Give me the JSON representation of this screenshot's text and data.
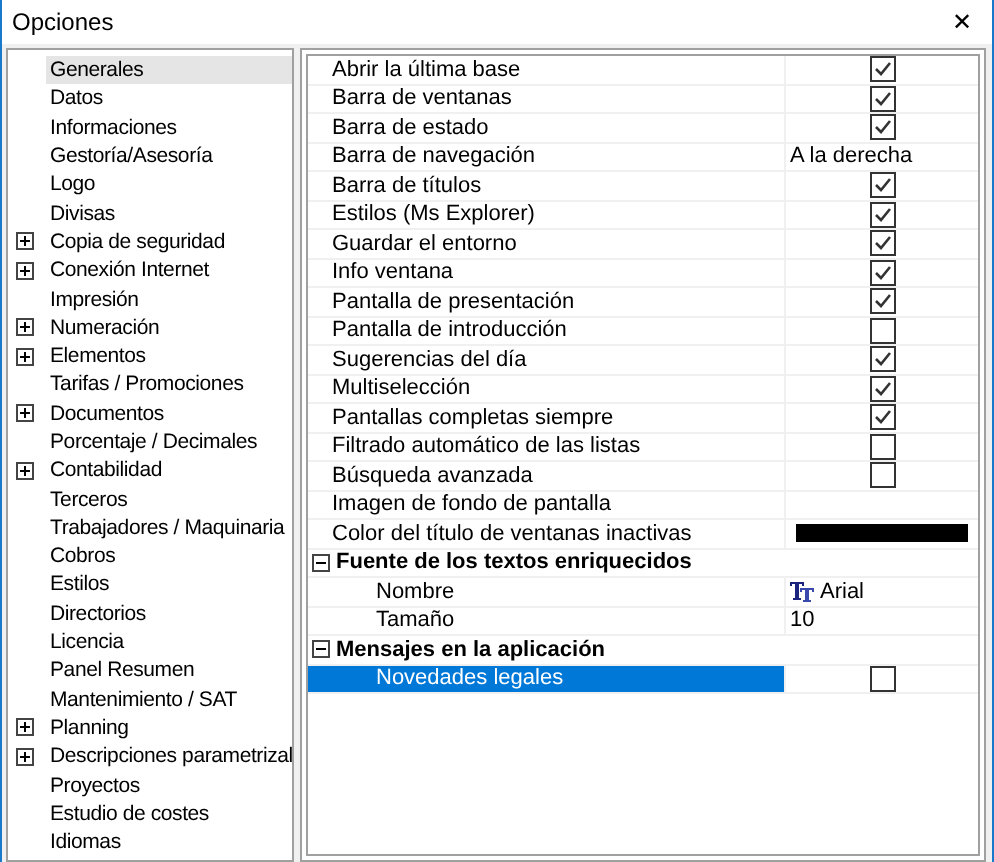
{
  "window": {
    "title": "Opciones",
    "close": "✕"
  },
  "tree": {
    "items": [
      {
        "label": "Generales",
        "expandable": false,
        "selected": true
      },
      {
        "label": "Datos",
        "expandable": false,
        "selected": false
      },
      {
        "label": "Informaciones",
        "expandable": false,
        "selected": false
      },
      {
        "label": "Gestoría/Asesoría",
        "expandable": false,
        "selected": false
      },
      {
        "label": "Logo",
        "expandable": false,
        "selected": false
      },
      {
        "label": "Divisas",
        "expandable": false,
        "selected": false
      },
      {
        "label": "Copia de seguridad",
        "expandable": true,
        "selected": false
      },
      {
        "label": "Conexión Internet",
        "expandable": true,
        "selected": false
      },
      {
        "label": "Impresión",
        "expandable": false,
        "selected": false
      },
      {
        "label": "Numeración",
        "expandable": true,
        "selected": false
      },
      {
        "label": "Elementos",
        "expandable": true,
        "selected": false
      },
      {
        "label": "Tarifas / Promociones",
        "expandable": false,
        "selected": false
      },
      {
        "label": "Documentos",
        "expandable": true,
        "selected": false
      },
      {
        "label": "Porcentaje / Decimales",
        "expandable": false,
        "selected": false
      },
      {
        "label": "Contabilidad",
        "expandable": true,
        "selected": false
      },
      {
        "label": "Terceros",
        "expandable": false,
        "selected": false
      },
      {
        "label": "Trabajadores / Maquinaria",
        "expandable": false,
        "selected": false
      },
      {
        "label": "Cobros",
        "expandable": false,
        "selected": false
      },
      {
        "label": "Estilos",
        "expandable": false,
        "selected": false
      },
      {
        "label": "Directorios",
        "expandable": false,
        "selected": false
      },
      {
        "label": "Licencia",
        "expandable": false,
        "selected": false
      },
      {
        "label": "Panel Resumen",
        "expandable": false,
        "selected": false
      },
      {
        "label": "Mantenimiento / SAT",
        "expandable": false,
        "selected": false
      },
      {
        "label": "Planning",
        "expandable": true,
        "selected": false
      },
      {
        "label": "Descripciones parametrizal",
        "expandable": true,
        "selected": false
      },
      {
        "label": "Proyectos",
        "expandable": false,
        "selected": false
      },
      {
        "label": "Estudio de costes",
        "expandable": false,
        "selected": false
      },
      {
        "label": "Idiomas",
        "expandable": false,
        "selected": false
      }
    ]
  },
  "properties": [
    {
      "kind": "checkbox",
      "name": "Abrir la última base",
      "checked": true,
      "selected": false
    },
    {
      "kind": "checkbox",
      "name": "Barra de ventanas",
      "checked": true,
      "selected": false
    },
    {
      "kind": "checkbox",
      "name": "Barra de estado",
      "checked": true,
      "selected": false
    },
    {
      "kind": "text",
      "name": "Barra de navegación",
      "value": "A la derecha",
      "selected": false
    },
    {
      "kind": "checkbox",
      "name": "Barra de títulos",
      "checked": true,
      "selected": false
    },
    {
      "kind": "checkbox",
      "name": "Estilos (Ms Explorer)",
      "checked": true,
      "selected": false
    },
    {
      "kind": "checkbox",
      "name": "Guardar el entorno",
      "checked": true,
      "selected": false
    },
    {
      "kind": "checkbox",
      "name": "Info ventana",
      "checked": true,
      "selected": false
    },
    {
      "kind": "checkbox",
      "name": "Pantalla de presentación",
      "checked": true,
      "selected": false
    },
    {
      "kind": "checkbox",
      "name": "Pantalla de introducción",
      "checked": false,
      "selected": false
    },
    {
      "kind": "checkbox",
      "name": "Sugerencias del día",
      "checked": true,
      "selected": false
    },
    {
      "kind": "checkbox",
      "name": "Multiselección",
      "checked": true,
      "selected": false
    },
    {
      "kind": "checkbox",
      "name": "Pantallas completas siempre",
      "checked": true,
      "selected": false
    },
    {
      "kind": "checkbox",
      "name": "Filtrado automático de las listas",
      "checked": false,
      "selected": false
    },
    {
      "kind": "checkbox",
      "name": "Búsqueda avanzada",
      "checked": false,
      "selected": false
    },
    {
      "kind": "empty",
      "name": "Imagen de fondo de pantalla",
      "selected": false
    },
    {
      "kind": "color",
      "name": "Color del título de ventanas inactivas",
      "color": "#000000",
      "selected": false
    },
    {
      "kind": "group",
      "name": "Fuente de los textos enriquecidos",
      "expanded": true,
      "children": [
        {
          "kind": "font",
          "name": "Nombre",
          "value": "Arial",
          "selected": false
        },
        {
          "kind": "text",
          "name": "Tamaño",
          "value": "10",
          "selected": false
        }
      ]
    },
    {
      "kind": "group",
      "name": "Mensajes en la aplicación",
      "expanded": true,
      "children": [
        {
          "kind": "checkbox",
          "name": "Novedades legales",
          "checked": false,
          "selected": true
        }
      ]
    }
  ]
}
